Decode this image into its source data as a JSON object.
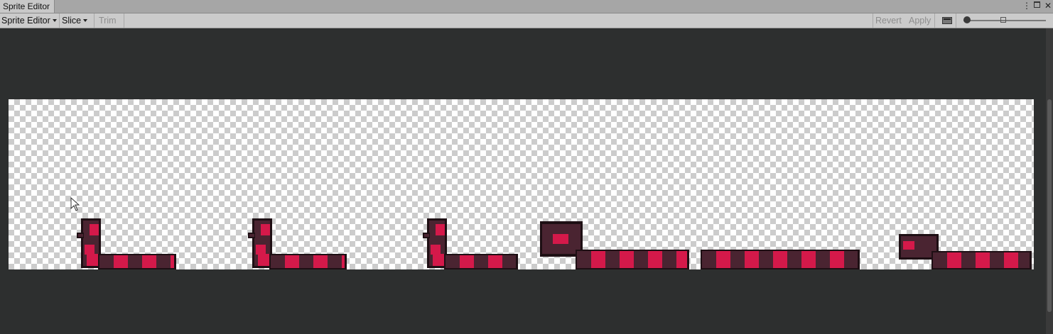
{
  "window": {
    "tab_title": "Sprite Editor",
    "menu_icon": "kebab-menu-icon",
    "maximize_icon": "maximize-icon",
    "close_icon": "close-icon"
  },
  "toolbar": {
    "sprite_editor_dropdown": "Sprite Editor",
    "slice_dropdown": "Slice",
    "trim_label": "Trim",
    "revert_label": "Revert",
    "apply_label": "Apply",
    "alpha_toggle_icon": "rgb-alpha-toggle-icon",
    "zoom_slider_level": 0.0
  },
  "canvas": {
    "background": "transparency-checkerboard",
    "sprite_count": 6,
    "colors": {
      "dark": "#4a2431",
      "red": "#d4194a",
      "outline": "#1e0f14"
    }
  }
}
